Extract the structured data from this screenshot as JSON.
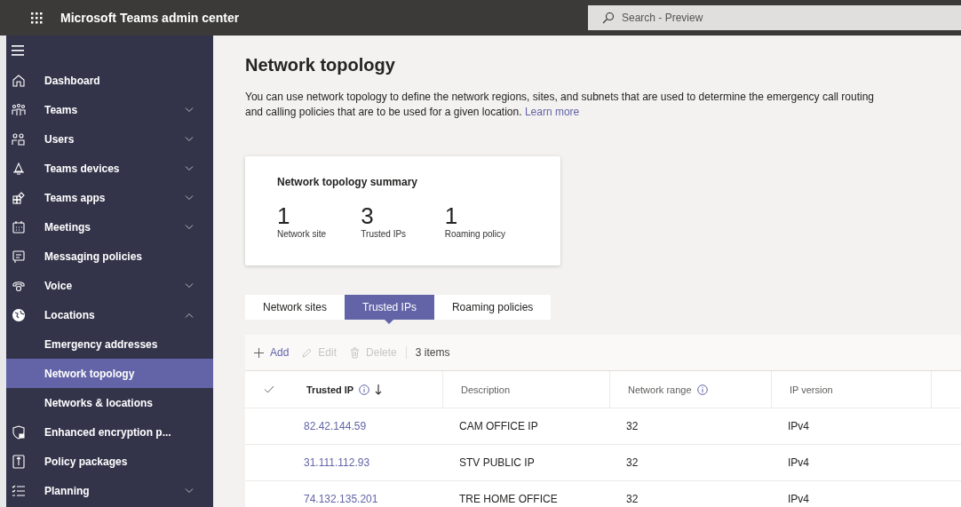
{
  "app_bar": {
    "title": "Microsoft Teams admin center",
    "search": {
      "placeholder": "Search - Preview"
    }
  },
  "sidebar": {
    "items": [
      {
        "label": "Dashboard",
        "kind": "link",
        "selected": false
      },
      {
        "label": "Teams",
        "kind": "group",
        "expanded": false,
        "selected": false
      },
      {
        "label": "Users",
        "kind": "group",
        "expanded": false,
        "selected": false
      },
      {
        "label": "Teams devices",
        "kind": "group",
        "expanded": false,
        "selected": false
      },
      {
        "label": "Teams apps",
        "kind": "group",
        "expanded": false,
        "selected": false
      },
      {
        "label": "Meetings",
        "kind": "group",
        "expanded": false,
        "selected": false
      },
      {
        "label": "Messaging policies",
        "kind": "link",
        "selected": false
      },
      {
        "label": "Voice",
        "kind": "group",
        "expanded": false,
        "selected": false
      },
      {
        "label": "Locations",
        "kind": "group",
        "expanded": true,
        "selected": false
      },
      {
        "label": "Emergency addresses",
        "kind": "sub",
        "selected": false
      },
      {
        "label": "Network topology",
        "kind": "sub",
        "selected": true
      },
      {
        "label": "Networks & locations",
        "kind": "sub",
        "selected": false
      },
      {
        "label": "Enhanced encryption p...",
        "kind": "link",
        "selected": false
      },
      {
        "label": "Policy packages",
        "kind": "link",
        "selected": false
      },
      {
        "label": "Planning",
        "kind": "group",
        "expanded": false,
        "selected": false
      }
    ]
  },
  "page": {
    "title": "Network topology",
    "description": "You can use network topology to define the network regions, sites, and subnets that are used to determine the emergency call routing and calling policies that are to be used for a given location.",
    "learn_more": "Learn more"
  },
  "summary": {
    "title": "Network topology summary",
    "stats": [
      {
        "value": "1",
        "label": "Network site"
      },
      {
        "value": "3",
        "label": "Trusted IPs"
      },
      {
        "value": "1",
        "label": "Roaming policy"
      }
    ]
  },
  "tabs": [
    {
      "label": "Network sites",
      "selected": false
    },
    {
      "label": "Trusted IPs",
      "selected": true
    },
    {
      "label": "Roaming policies",
      "selected": false
    }
  ],
  "toolbar": {
    "actions": [
      {
        "label": "Add",
        "disabled": false
      },
      {
        "label": "Edit",
        "disabled": true
      },
      {
        "label": "Delete",
        "disabled": true
      }
    ],
    "count": "3 items"
  },
  "table": {
    "columns": [
      {
        "label": "Trusted IP",
        "info": true,
        "sorted": true
      },
      {
        "label": "Description",
        "info": false,
        "sorted": false
      },
      {
        "label": "Network range",
        "info": true,
        "sorted": false
      },
      {
        "label": "IP version",
        "info": false,
        "sorted": false
      }
    ],
    "rows": [
      {
        "cells": [
          "82.42.144.59",
          "CAM OFFICE IP",
          "32",
          "IPv4"
        ]
      },
      {
        "cells": [
          "31.111.112.93",
          "STV PUBLIC IP",
          "32",
          "IPv4"
        ]
      },
      {
        "cells": [
          "74.132.135.201",
          "TRE HOME OFFICE",
          "32",
          "IPv4"
        ]
      }
    ]
  }
}
